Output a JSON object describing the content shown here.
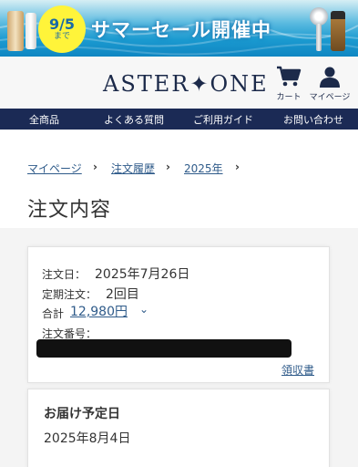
{
  "banner": {
    "date_top": "9/5",
    "date_bottom": "まで",
    "sale_text": "サマーセール開催中"
  },
  "header": {
    "logo": "ASTER✦ONE",
    "cart_label": "カート",
    "mypage_label": "マイページ"
  },
  "nav": {
    "items": [
      "全商品",
      "よくある質問",
      "ご利用ガイド",
      "お問い合わせ"
    ]
  },
  "breadcrumb": {
    "items": [
      "マイページ",
      "注文履歴",
      "2025年"
    ],
    "separator": "›"
  },
  "page_title": "注文内容",
  "order": {
    "date_label": "注文日：",
    "date_value": "2025年7月26日",
    "subscription_label": "定期注文：",
    "subscription_value": "2回目",
    "total_label": "合計",
    "total_value": "12,980円",
    "total_chevron": "⌄",
    "order_number_label": "注文番号：",
    "receipt_link": "領収書"
  },
  "delivery": {
    "title": "お届け予定日",
    "date": "2025年8月4日"
  },
  "colors": {
    "nav_bg": "#1b2a55",
    "link": "#2f5b8a",
    "badge": "#fff43a"
  }
}
